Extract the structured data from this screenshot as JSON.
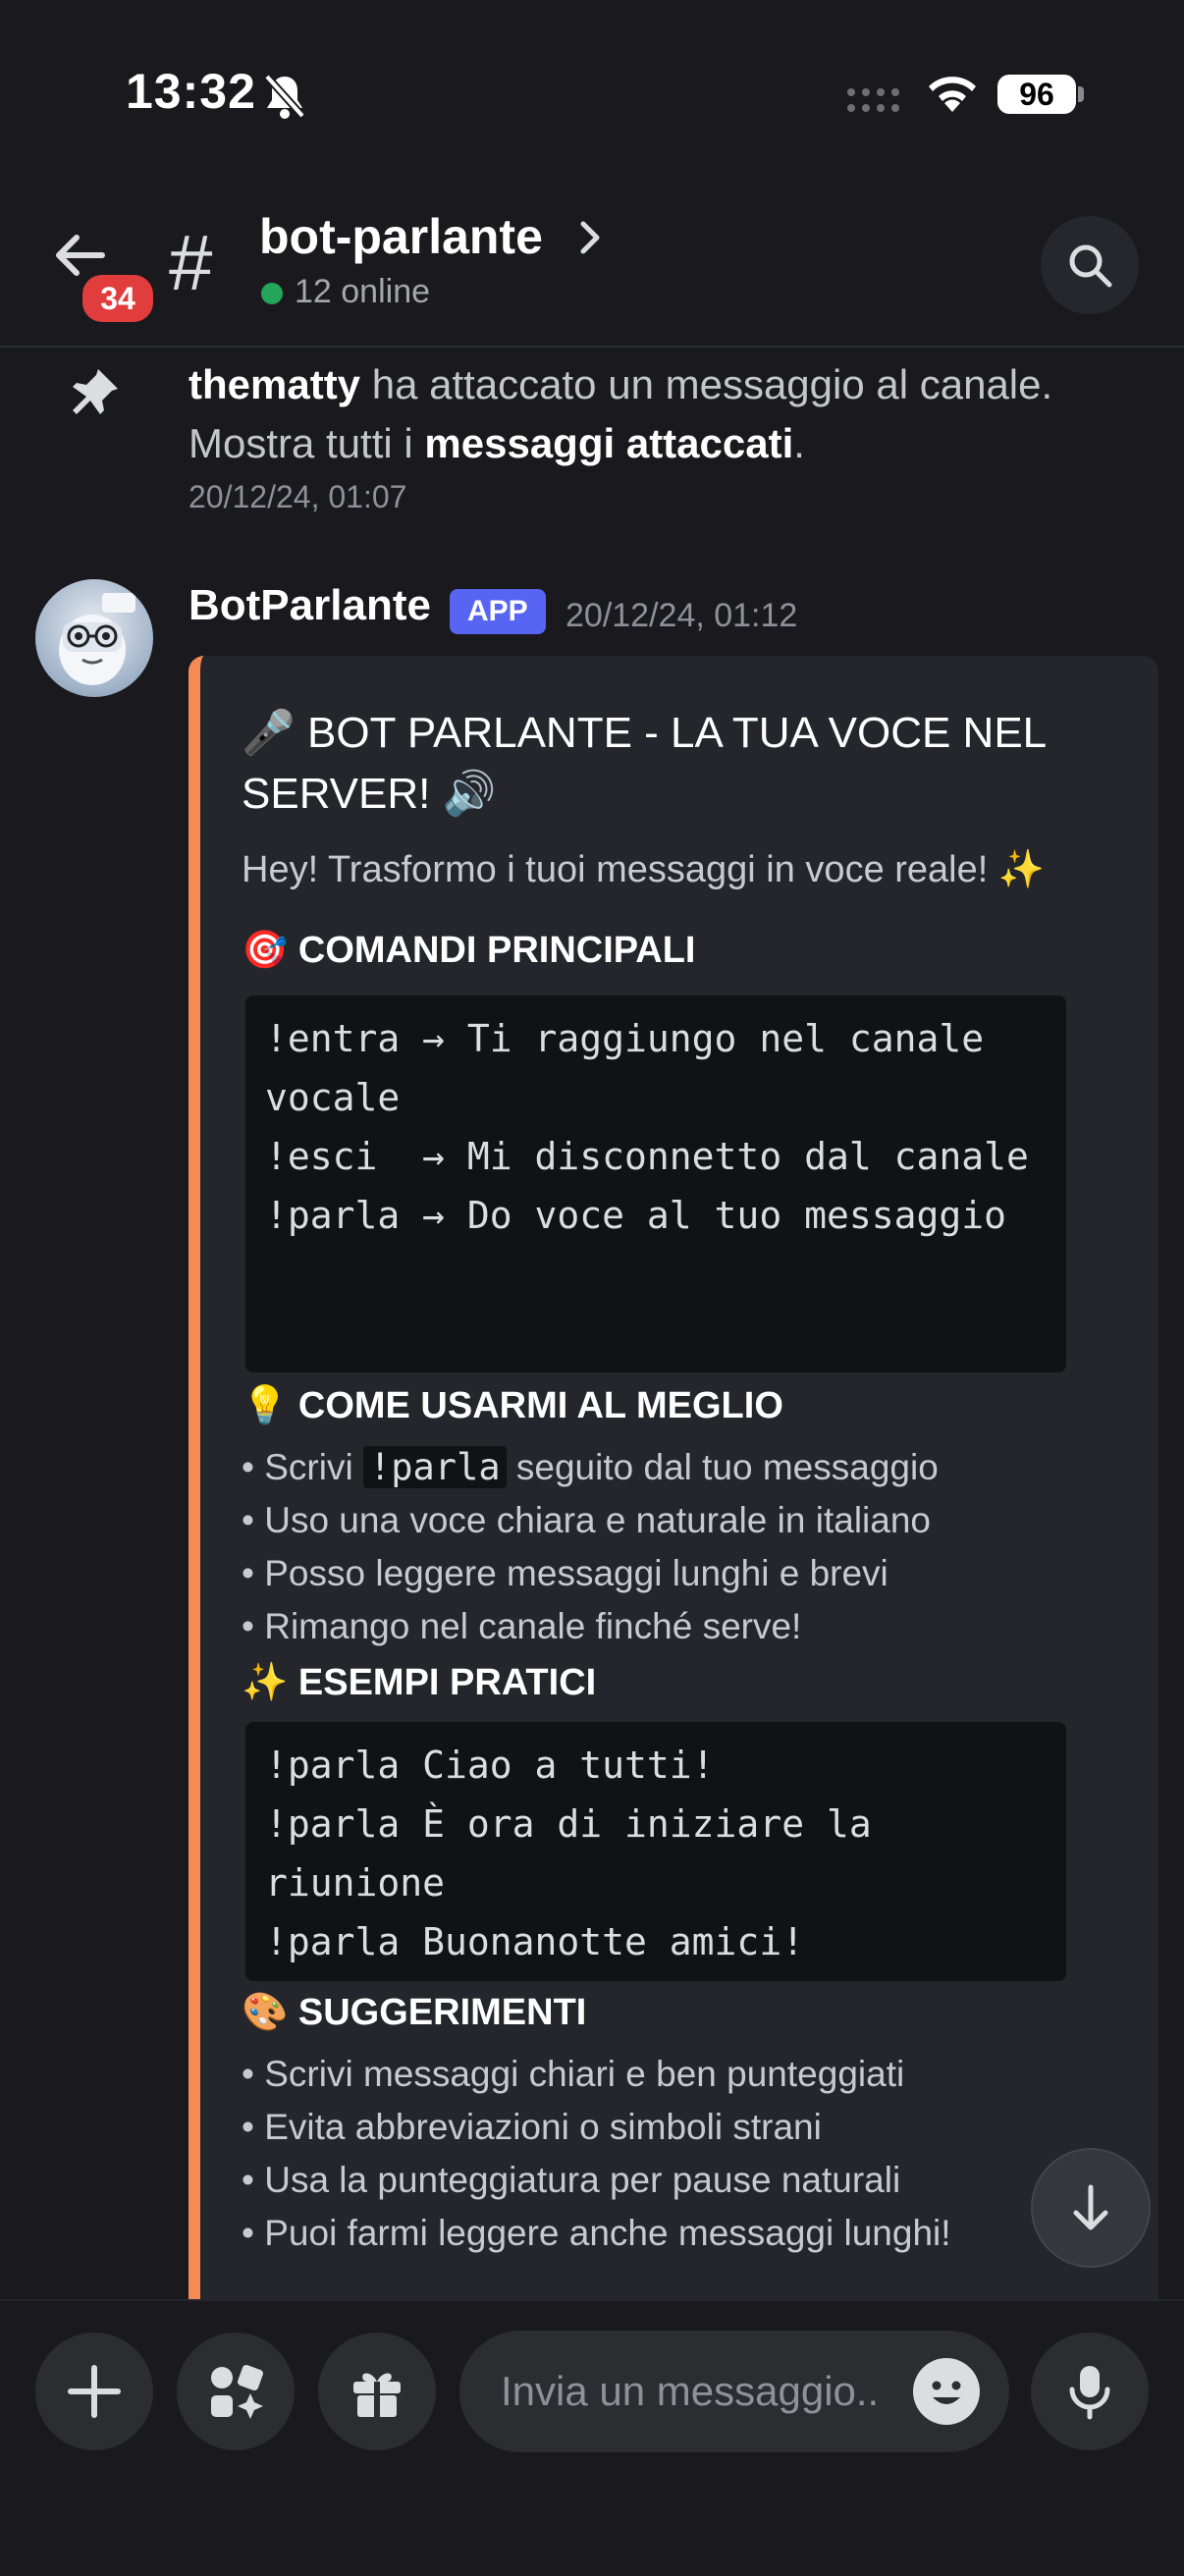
{
  "status_bar": {
    "time": "13:32",
    "battery": "96"
  },
  "header": {
    "back_badge": "34",
    "channel_symbol": "#",
    "channel_name": "bot-parlante",
    "online_text": "12 online"
  },
  "system_message": {
    "user": "thematty",
    "text_mid": " ha attaccato un messaggio al canale. Mostra tutti i ",
    "link": "messaggi attaccati",
    "end": ".",
    "timestamp": "20/12/24, 01:07"
  },
  "bot_message": {
    "author": "BotParlante",
    "tag": "APP",
    "timestamp": "20/12/24, 01:12",
    "embed": {
      "accent_color": "#f78b55",
      "title": "🎤 BOT PARLANTE - LA TUA VOCE NEL SERVER! 🔊",
      "description": "Hey! Trasformo i tuoi messaggi in voce reale! ✨",
      "section1_title": "🎯 COMANDI PRINCIPALI",
      "section1_code": "!entra → Ti raggiungo nel canale vocale\n!esci  → Mi disconnetto dal canale\n!parla → Do voce al tuo messaggio",
      "section2_title": "💡 COME USARMI AL MEGLIO",
      "section2_bullet1_pre": "• Scrivi ",
      "section2_bullet1_code": "!parla",
      "section2_bullet1_post": " seguito dal tuo messaggio",
      "section2_bullets": [
        "• Uso una voce chiara e naturale in italiano",
        "• Posso leggere messaggi lunghi e brevi",
        "• Rimango nel canale finché serve!"
      ],
      "section3_title": "✨ ESEMPI PRATICI",
      "section3_code": "!parla Ciao a tutti!\n!parla È ora di iniziare la riunione\n!parla Buonanotte amici!",
      "section4_title": "🎨 SUGGERIMENTI",
      "section4_bullets": [
        "• Scrivi messaggi chiari e ben punteggiati",
        "• Evita abbreviazioni o simboli strani",
        "• Usa la punteggiatura per pause naturali",
        "• Puoi farmi leggere anche messaggi lunghi!"
      ]
    }
  },
  "composer": {
    "placeholder": "Invia un messaggio.."
  }
}
